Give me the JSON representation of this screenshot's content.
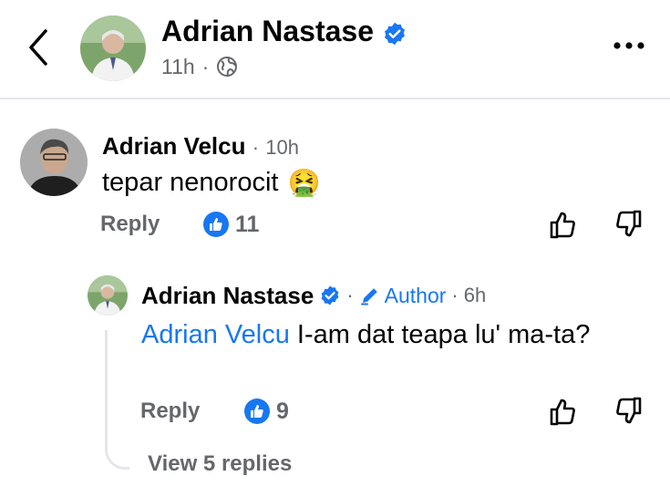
{
  "header": {
    "author_name": "Adrian Nastase",
    "time": "11h",
    "dot": "·"
  },
  "comments": [
    {
      "author": "Adrian Velcu",
      "sep": "·",
      "time": "10h",
      "text": "tepar nenorocit",
      "emoji": "🤮",
      "reply_label": "Reply",
      "reaction_count": "11"
    },
    {
      "author": "Adrian Nastase",
      "sep": "·",
      "author_badge": "Author",
      "sep2": "·",
      "time": "6h",
      "mention": "Adrian Velcu",
      "text": " I-am dat teapa lu' ma-ta?",
      "reply_label": "Reply",
      "reaction_count": "9"
    }
  ],
  "view_replies_label": "View 5 replies",
  "colors": {
    "accent": "#1877f2",
    "secondary_text": "#65676b",
    "divider": "#e4e6eb"
  },
  "icons": [
    "back-icon",
    "verified-badge-icon",
    "globe-icon",
    "more-icon",
    "like-reaction-icon",
    "thumbs-up-icon",
    "thumbs-down-icon",
    "pencil-icon"
  ]
}
